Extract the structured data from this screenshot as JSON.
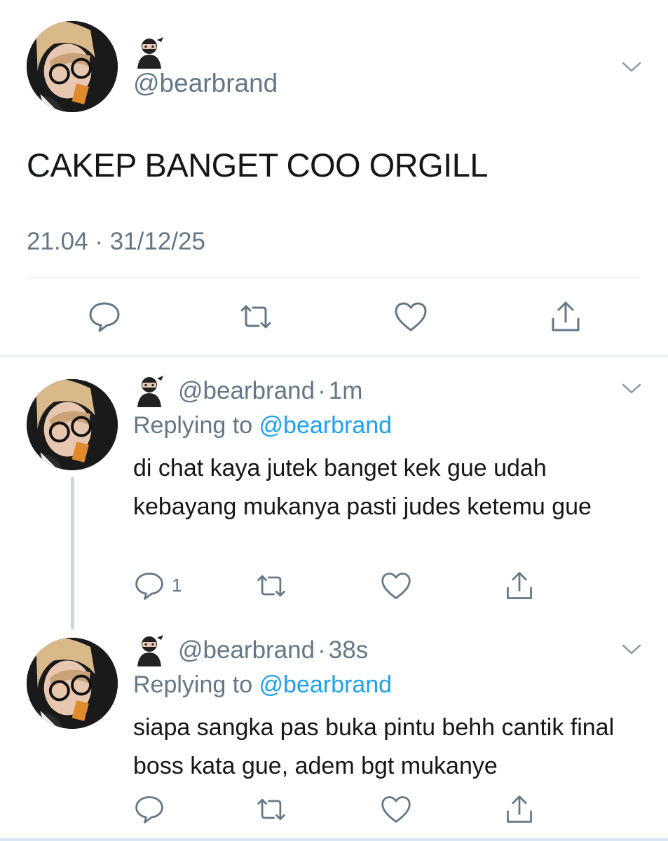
{
  "main_tweet": {
    "handle": "@bearbrand",
    "text": "CAKEP BANGET COO ORGILL",
    "time": "21.04",
    "separator": "·",
    "date": "31/12/25",
    "actions": [
      "reply-icon",
      "retweet-icon",
      "like-icon",
      "share-icon"
    ]
  },
  "replies": [
    {
      "handle": "@bearbrand",
      "separator": "·",
      "age": "1m",
      "replying_prefix": "Replying to ",
      "replying_to": "@bearbrand",
      "text": "di chat kaya jutek banget kek gue udah kebayang mukanya pasti judes ketemu gue",
      "reply_count": "1"
    },
    {
      "handle": "@bearbrand",
      "separator": "·",
      "age": "38s",
      "replying_prefix": "Replying to ",
      "replying_to": "@bearbrand",
      "text": "siapa sangka pas buka pintu behh cantik final boss kata gue, adem bgt mukanye",
      "reply_count": ""
    }
  ],
  "colors": {
    "primary_text": "#14171a",
    "secondary_text": "#657786",
    "link": "#1da1f2",
    "divider": "#e1e8ed",
    "thread_line": "#ccd6dd"
  }
}
